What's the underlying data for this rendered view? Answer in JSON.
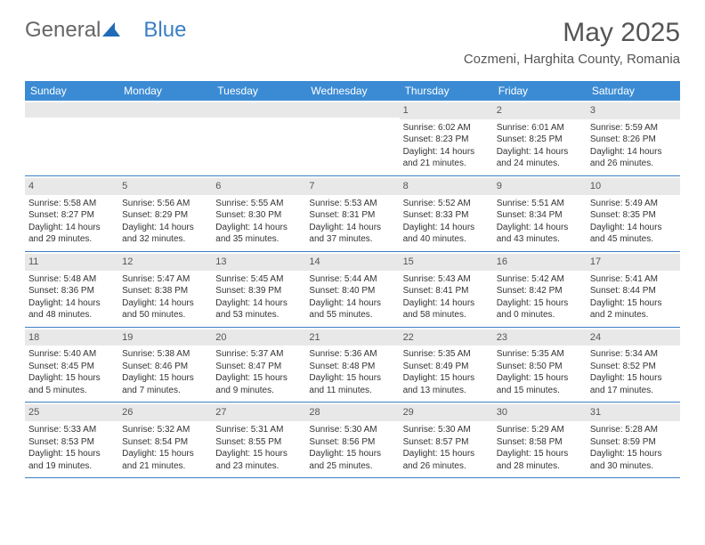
{
  "brand": {
    "part1": "General",
    "part2": "Blue"
  },
  "title": "May 2025",
  "location": "Cozmeni, Harghita County, Romania",
  "weekdays": [
    "Sunday",
    "Monday",
    "Tuesday",
    "Wednesday",
    "Thursday",
    "Friday",
    "Saturday"
  ],
  "cells": [
    {
      "day": "",
      "sunrise": "",
      "sunset": "",
      "daylight1": "",
      "daylight2": ""
    },
    {
      "day": "",
      "sunrise": "",
      "sunset": "",
      "daylight1": "",
      "daylight2": ""
    },
    {
      "day": "",
      "sunrise": "",
      "sunset": "",
      "daylight1": "",
      "daylight2": ""
    },
    {
      "day": "",
      "sunrise": "",
      "sunset": "",
      "daylight1": "",
      "daylight2": ""
    },
    {
      "day": "1",
      "sunrise": "Sunrise: 6:02 AM",
      "sunset": "Sunset: 8:23 PM",
      "daylight1": "Daylight: 14 hours",
      "daylight2": "and 21 minutes."
    },
    {
      "day": "2",
      "sunrise": "Sunrise: 6:01 AM",
      "sunset": "Sunset: 8:25 PM",
      "daylight1": "Daylight: 14 hours",
      "daylight2": "and 24 minutes."
    },
    {
      "day": "3",
      "sunrise": "Sunrise: 5:59 AM",
      "sunset": "Sunset: 8:26 PM",
      "daylight1": "Daylight: 14 hours",
      "daylight2": "and 26 minutes."
    },
    {
      "day": "4",
      "sunrise": "Sunrise: 5:58 AM",
      "sunset": "Sunset: 8:27 PM",
      "daylight1": "Daylight: 14 hours",
      "daylight2": "and 29 minutes."
    },
    {
      "day": "5",
      "sunrise": "Sunrise: 5:56 AM",
      "sunset": "Sunset: 8:29 PM",
      "daylight1": "Daylight: 14 hours",
      "daylight2": "and 32 minutes."
    },
    {
      "day": "6",
      "sunrise": "Sunrise: 5:55 AM",
      "sunset": "Sunset: 8:30 PM",
      "daylight1": "Daylight: 14 hours",
      "daylight2": "and 35 minutes."
    },
    {
      "day": "7",
      "sunrise": "Sunrise: 5:53 AM",
      "sunset": "Sunset: 8:31 PM",
      "daylight1": "Daylight: 14 hours",
      "daylight2": "and 37 minutes."
    },
    {
      "day": "8",
      "sunrise": "Sunrise: 5:52 AM",
      "sunset": "Sunset: 8:33 PM",
      "daylight1": "Daylight: 14 hours",
      "daylight2": "and 40 minutes."
    },
    {
      "day": "9",
      "sunrise": "Sunrise: 5:51 AM",
      "sunset": "Sunset: 8:34 PM",
      "daylight1": "Daylight: 14 hours",
      "daylight2": "and 43 minutes."
    },
    {
      "day": "10",
      "sunrise": "Sunrise: 5:49 AM",
      "sunset": "Sunset: 8:35 PM",
      "daylight1": "Daylight: 14 hours",
      "daylight2": "and 45 minutes."
    },
    {
      "day": "11",
      "sunrise": "Sunrise: 5:48 AM",
      "sunset": "Sunset: 8:36 PM",
      "daylight1": "Daylight: 14 hours",
      "daylight2": "and 48 minutes."
    },
    {
      "day": "12",
      "sunrise": "Sunrise: 5:47 AM",
      "sunset": "Sunset: 8:38 PM",
      "daylight1": "Daylight: 14 hours",
      "daylight2": "and 50 minutes."
    },
    {
      "day": "13",
      "sunrise": "Sunrise: 5:45 AM",
      "sunset": "Sunset: 8:39 PM",
      "daylight1": "Daylight: 14 hours",
      "daylight2": "and 53 minutes."
    },
    {
      "day": "14",
      "sunrise": "Sunrise: 5:44 AM",
      "sunset": "Sunset: 8:40 PM",
      "daylight1": "Daylight: 14 hours",
      "daylight2": "and 55 minutes."
    },
    {
      "day": "15",
      "sunrise": "Sunrise: 5:43 AM",
      "sunset": "Sunset: 8:41 PM",
      "daylight1": "Daylight: 14 hours",
      "daylight2": "and 58 minutes."
    },
    {
      "day": "16",
      "sunrise": "Sunrise: 5:42 AM",
      "sunset": "Sunset: 8:42 PM",
      "daylight1": "Daylight: 15 hours",
      "daylight2": "and 0 minutes."
    },
    {
      "day": "17",
      "sunrise": "Sunrise: 5:41 AM",
      "sunset": "Sunset: 8:44 PM",
      "daylight1": "Daylight: 15 hours",
      "daylight2": "and 2 minutes."
    },
    {
      "day": "18",
      "sunrise": "Sunrise: 5:40 AM",
      "sunset": "Sunset: 8:45 PM",
      "daylight1": "Daylight: 15 hours",
      "daylight2": "and 5 minutes."
    },
    {
      "day": "19",
      "sunrise": "Sunrise: 5:38 AM",
      "sunset": "Sunset: 8:46 PM",
      "daylight1": "Daylight: 15 hours",
      "daylight2": "and 7 minutes."
    },
    {
      "day": "20",
      "sunrise": "Sunrise: 5:37 AM",
      "sunset": "Sunset: 8:47 PM",
      "daylight1": "Daylight: 15 hours",
      "daylight2": "and 9 minutes."
    },
    {
      "day": "21",
      "sunrise": "Sunrise: 5:36 AM",
      "sunset": "Sunset: 8:48 PM",
      "daylight1": "Daylight: 15 hours",
      "daylight2": "and 11 minutes."
    },
    {
      "day": "22",
      "sunrise": "Sunrise: 5:35 AM",
      "sunset": "Sunset: 8:49 PM",
      "daylight1": "Daylight: 15 hours",
      "daylight2": "and 13 minutes."
    },
    {
      "day": "23",
      "sunrise": "Sunrise: 5:35 AM",
      "sunset": "Sunset: 8:50 PM",
      "daylight1": "Daylight: 15 hours",
      "daylight2": "and 15 minutes."
    },
    {
      "day": "24",
      "sunrise": "Sunrise: 5:34 AM",
      "sunset": "Sunset: 8:52 PM",
      "daylight1": "Daylight: 15 hours",
      "daylight2": "and 17 minutes."
    },
    {
      "day": "25",
      "sunrise": "Sunrise: 5:33 AM",
      "sunset": "Sunset: 8:53 PM",
      "daylight1": "Daylight: 15 hours",
      "daylight2": "and 19 minutes."
    },
    {
      "day": "26",
      "sunrise": "Sunrise: 5:32 AM",
      "sunset": "Sunset: 8:54 PM",
      "daylight1": "Daylight: 15 hours",
      "daylight2": "and 21 minutes."
    },
    {
      "day": "27",
      "sunrise": "Sunrise: 5:31 AM",
      "sunset": "Sunset: 8:55 PM",
      "daylight1": "Daylight: 15 hours",
      "daylight2": "and 23 minutes."
    },
    {
      "day": "28",
      "sunrise": "Sunrise: 5:30 AM",
      "sunset": "Sunset: 8:56 PM",
      "daylight1": "Daylight: 15 hours",
      "daylight2": "and 25 minutes."
    },
    {
      "day": "29",
      "sunrise": "Sunrise: 5:30 AM",
      "sunset": "Sunset: 8:57 PM",
      "daylight1": "Daylight: 15 hours",
      "daylight2": "and 26 minutes."
    },
    {
      "day": "30",
      "sunrise": "Sunrise: 5:29 AM",
      "sunset": "Sunset: 8:58 PM",
      "daylight1": "Daylight: 15 hours",
      "daylight2": "and 28 minutes."
    },
    {
      "day": "31",
      "sunrise": "Sunrise: 5:28 AM",
      "sunset": "Sunset: 8:59 PM",
      "daylight1": "Daylight: 15 hours",
      "daylight2": "and 30 minutes."
    }
  ]
}
